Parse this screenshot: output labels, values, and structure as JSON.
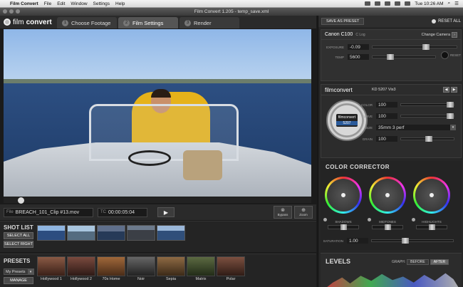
{
  "menubar": {
    "app": "Film Convert",
    "items": [
      "File",
      "Edit",
      "Window",
      "Settings",
      "Help"
    ],
    "time": "Tue 10:26 AM"
  },
  "window": {
    "title": "Film Convert 1.205 - temp_save.xml"
  },
  "logo": {
    "text_light": "film",
    "text_bold": "convert"
  },
  "tabs": [
    {
      "num": "1",
      "label": "Choose Footage"
    },
    {
      "num": "2",
      "label": "Film Settings"
    },
    {
      "num": "3",
      "label": "Render"
    }
  ],
  "transport": {
    "file_label": "File",
    "file_name": "BREACH_101_Clip #13.mov",
    "timecode_label": "TC",
    "timecode": "00:00:05:04",
    "play_icon": "play-icon",
    "bypass_label": "Bypass",
    "zoom_label": "Zoom"
  },
  "shot_list": {
    "title": "SHOT LIST",
    "select_all": "SELECT ALL",
    "select_right": "SELECT RIGHT"
  },
  "presets": {
    "title": "PRESETS",
    "dropdown_value": "My Presets",
    "manage": "MANAGE",
    "items": [
      {
        "name": "Hollywood 1",
        "color": "#6b3b2a"
      },
      {
        "name": "Hollywood 2",
        "color": "#553228"
      },
      {
        "name": "70s Home",
        "color": "#7a4a26"
      },
      {
        "name": "Noir",
        "color": "#444444"
      },
      {
        "name": "Sepia",
        "color": "#6a4a2e"
      },
      {
        "name": "Matrix",
        "color": "#3e4a2e"
      },
      {
        "name": "Polar",
        "color": "#5a3a2a"
      }
    ]
  },
  "panel": {
    "save_as_preset": "SAVE AS PRESET",
    "reset_all": "RESET ALL",
    "camera": {
      "name": "Canon C100",
      "sub": "C Log",
      "change": "Change Camera",
      "exposure_label": "EXPOSURE",
      "exposure": "-0.09",
      "temp_label": "TEMP",
      "temp": "5600",
      "reset": "RESET"
    },
    "film": {
      "brand": "filmconvert",
      "stock": "KD 5207 Vis3",
      "can_brand": "filmconvert",
      "can_number": "5207",
      "color_label": "COLOR",
      "color": "100",
      "curve_label": "CURVE",
      "curve": "100",
      "size_label": "SIZE",
      "size": "35mm 3 perf",
      "grain_label": "GRAIN",
      "grain": "100"
    },
    "color_corrector": {
      "title": "COLOR CORRECTOR",
      "shadows": "SHADOWS",
      "midtones": "MIDTONES",
      "highlights": "HIGHLIGHTS",
      "saturation_label": "SATURATION",
      "saturation": "1.00"
    },
    "levels": {
      "title": "LEVELS",
      "graph_label": "GRAPH:",
      "before": "BEFORE",
      "after": "AFTER"
    }
  }
}
